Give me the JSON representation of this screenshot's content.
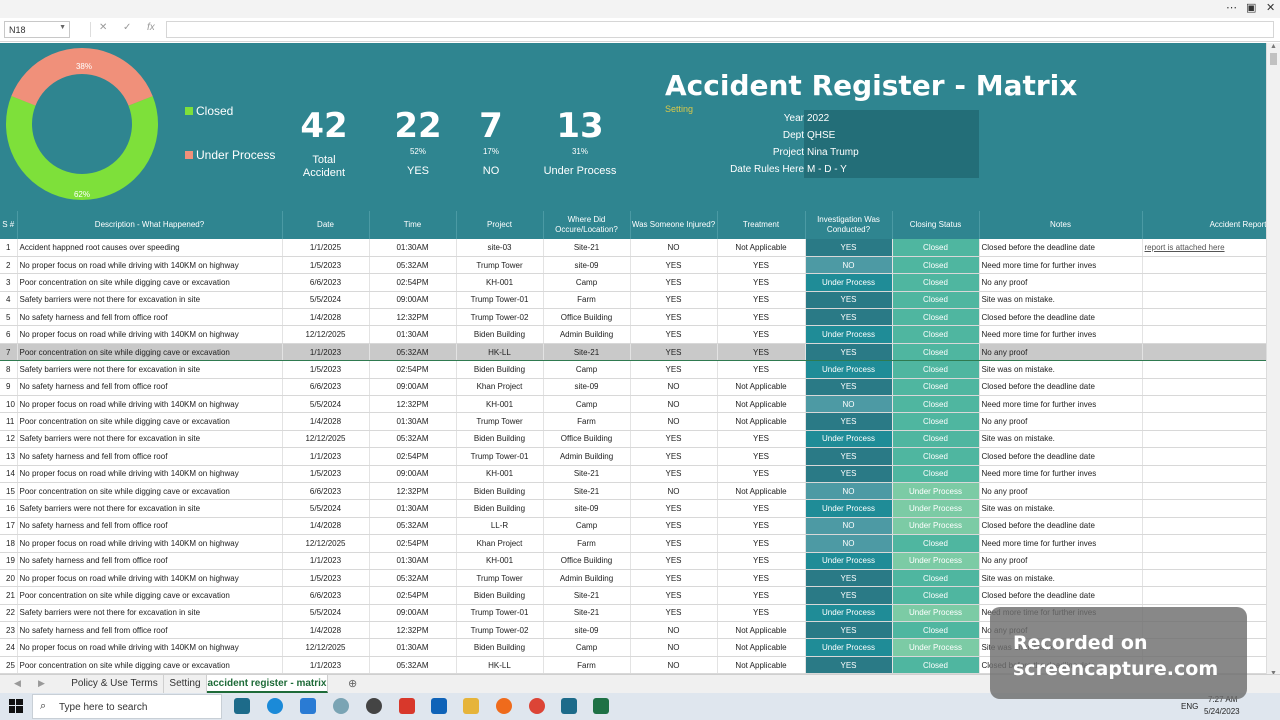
{
  "window": {
    "controls": [
      "⋯",
      "▣",
      "—",
      "☐",
      "✕"
    ]
  },
  "formula_bar": {
    "name_box": "N18",
    "cancel": "✕",
    "enter": "✓",
    "fx": "fx",
    "value": ""
  },
  "dashboard": {
    "title": "Accident Register - Matrix",
    "setting_link": "Setting",
    "donut": {
      "closed_pct_label": "62%",
      "under_process_pct_label": "38%",
      "closed_fraction": 0.62,
      "colors": {
        "closed": "#7ee03a",
        "under_process": "#f0907a"
      }
    },
    "legend": {
      "closed": "Closed",
      "under_process": "Under Process"
    },
    "kpis": [
      {
        "value": "42",
        "pct": "",
        "label": "Total Accident"
      },
      {
        "value": "22",
        "pct": "52%",
        "label": "YES"
      },
      {
        "value": "7",
        "pct": "17%",
        "label": "NO"
      },
      {
        "value": "13",
        "pct": "31%",
        "label": "Under Process"
      }
    ],
    "meta": [
      {
        "key": "Year",
        "value": "2022"
      },
      {
        "key": "Dept",
        "value": "QHSE"
      },
      {
        "key": "Project",
        "value": "Nina Trump"
      },
      {
        "key": "Date Rules Here",
        "value": "M - D - Y"
      }
    ]
  },
  "table": {
    "headers": [
      "S #",
      "Description - What Happened?",
      "Date",
      "Time",
      "Project",
      "Where Did Occure/Location?",
      "Was Someone Injured?",
      "Treatment",
      "Investigation Was Conducted?",
      "Closing Status",
      "Notes",
      "Accident Report"
    ],
    "rows": [
      [
        "1",
        "Accident happned root causes over speeding",
        "1/1/2025",
        "01:30AM",
        "site-03",
        "Site-21",
        "NO",
        "Not Applicable",
        "YES",
        "Closed",
        "Closed before the deadline date",
        "report is attached here"
      ],
      [
        "2",
        "No proper focus on road while driving with 140KM on highway",
        "1/5/2023",
        "05:32AM",
        "Trump Tower",
        "site-09",
        "YES",
        "YES",
        "NO",
        "Closed",
        "Need more time for further inves",
        ""
      ],
      [
        "3",
        "Poor concentration on site while digging cave or excavation",
        "6/6/2023",
        "02:54PM",
        "KH-001",
        "Camp",
        "YES",
        "YES",
        "Under Process",
        "Closed",
        "No any proof",
        ""
      ],
      [
        "4",
        "Safety barriers were not there for excavation in site",
        "5/5/2024",
        "09:00AM",
        "Trump Tower-01",
        "Farm",
        "YES",
        "YES",
        "YES",
        "Closed",
        "Site was on mistake.",
        ""
      ],
      [
        "5",
        "No safety harness and fell from office roof",
        "1/4/2028",
        "12:32PM",
        "Trump Tower-02",
        "Office Building",
        "YES",
        "YES",
        "YES",
        "Closed",
        "Closed before the deadline date",
        ""
      ],
      [
        "6",
        "No proper focus on road while driving with 140KM on highway",
        "12/12/2025",
        "01:30AM",
        "Biden Building",
        "Admin Building",
        "YES",
        "YES",
        "Under Process",
        "Closed",
        "Need more time for further inves",
        ""
      ],
      [
        "7",
        "Poor concentration on site while digging cave or excavation",
        "1/1/2023",
        "05:32AM",
        "HK-LL",
        "Site-21",
        "YES",
        "YES",
        "YES",
        "Closed",
        "No any proof",
        ""
      ],
      [
        "8",
        "Safety barriers were not there for excavation in site",
        "1/5/2023",
        "02:54PM",
        "Biden Building",
        "Camp",
        "YES",
        "YES",
        "Under Process",
        "Closed",
        "Site was on mistake.",
        ""
      ],
      [
        "9",
        "No safety harness and fell from office roof",
        "6/6/2023",
        "09:00AM",
        "Khan Project",
        "site-09",
        "NO",
        "Not Applicable",
        "YES",
        "Closed",
        "Closed before the deadline date",
        ""
      ],
      [
        "10",
        "No proper focus on road while driving with 140KM on highway",
        "5/5/2024",
        "12:32PM",
        "KH-001",
        "Camp",
        "NO",
        "Not Applicable",
        "NO",
        "Closed",
        "Need more time for further inves",
        ""
      ],
      [
        "11",
        "Poor concentration on site while digging cave or excavation",
        "1/4/2028",
        "01:30AM",
        "Trump Tower",
        "Farm",
        "NO",
        "Not Applicable",
        "YES",
        "Closed",
        "No any proof",
        ""
      ],
      [
        "12",
        "Safety barriers were not there for excavation in site",
        "12/12/2025",
        "05:32AM",
        "Biden Building",
        "Office Building",
        "YES",
        "YES",
        "Under Process",
        "Closed",
        "Site was on mistake.",
        ""
      ],
      [
        "13",
        "No safety harness and fell from office roof",
        "1/1/2023",
        "02:54PM",
        "Trump Tower-01",
        "Admin Building",
        "YES",
        "YES",
        "YES",
        "Closed",
        "Closed before the deadline date",
        ""
      ],
      [
        "14",
        "No proper focus on road while driving with 140KM on highway",
        "1/5/2023",
        "09:00AM",
        "KH-001",
        "Site-21",
        "YES",
        "YES",
        "YES",
        "Closed",
        "Need more time for further inves",
        ""
      ],
      [
        "15",
        "Poor concentration on site while digging cave or excavation",
        "6/6/2023",
        "12:32PM",
        "Biden Building",
        "Site-21",
        "NO",
        "Not Applicable",
        "NO",
        "Under Process",
        "No any proof",
        ""
      ],
      [
        "16",
        "Safety barriers were not there for excavation in site",
        "5/5/2024",
        "01:30AM",
        "Biden Building",
        "site-09",
        "YES",
        "YES",
        "Under Process",
        "Under Process",
        "Site was on mistake.",
        ""
      ],
      [
        "17",
        "No safety harness and fell from office roof",
        "1/4/2028",
        "05:32AM",
        "LL-R",
        "Camp",
        "YES",
        "YES",
        "NO",
        "Under Process",
        "Closed before the deadline date",
        ""
      ],
      [
        "18",
        "No proper focus on road while driving with 140KM on highway",
        "12/12/2025",
        "02:54PM",
        "Khan Project",
        "Farm",
        "YES",
        "YES",
        "NO",
        "Closed",
        "Need more time for further inves",
        ""
      ],
      [
        "19",
        "No safety harness and fell from office roof",
        "1/1/2023",
        "01:30AM",
        "KH-001",
        "Office Building",
        "YES",
        "YES",
        "Under Process",
        "Under Process",
        "No any proof",
        ""
      ],
      [
        "20",
        "No proper focus on road while driving with 140KM on highway",
        "1/5/2023",
        "05:32AM",
        "Trump Tower",
        "Admin Building",
        "YES",
        "YES",
        "YES",
        "Closed",
        "Site was on mistake.",
        ""
      ],
      [
        "21",
        "Poor concentration on site while digging cave or excavation",
        "6/6/2023",
        "02:54PM",
        "Biden Building",
        "Site-21",
        "YES",
        "YES",
        "YES",
        "Closed",
        "Closed before the deadline date",
        ""
      ],
      [
        "22",
        "Safety barriers were not there for excavation in site",
        "5/5/2024",
        "09:00AM",
        "Trump Tower-01",
        "Site-21",
        "YES",
        "YES",
        "Under Process",
        "Under Process",
        "Need more time for further inves",
        ""
      ],
      [
        "23",
        "No safety harness and fell from office roof",
        "1/4/2028",
        "12:32PM",
        "Trump Tower-02",
        "site-09",
        "NO",
        "Not Applicable",
        "YES",
        "Closed",
        "No any proof",
        ""
      ],
      [
        "24",
        "No proper focus on road while driving with 140KM on highway",
        "12/12/2025",
        "01:30AM",
        "Biden Building",
        "Camp",
        "NO",
        "Not Applicable",
        "Under Process",
        "Under Process",
        "Site was on mistake.",
        ""
      ],
      [
        "25",
        "Poor concentration on site while digging cave or excavation",
        "1/1/2023",
        "05:32AM",
        "HK-LL",
        "Farm",
        "NO",
        "Not Applicable",
        "YES",
        "Closed",
        "Closed before the deadline date",
        ""
      ]
    ],
    "selected_row": 7,
    "colors": {
      "inv_yes": "#2a7a86",
      "inv_no": "#4d9aa4",
      "inv_process": "#1f8c97",
      "closed": "#4fb6a0",
      "under_process": "#7ccba5"
    }
  },
  "sheet_tabs": [
    "Policy & Use Terms",
    "Setting",
    "accident register - matrix"
  ],
  "active_tab": "accident register - matrix",
  "taskbar": {
    "search_placeholder": "Type here to search",
    "tray_lang": "ENG",
    "time": "7:27 AM",
    "date": "5/24/2023"
  },
  "watermark": {
    "line1": "Recorded on",
    "line2": "screencapture.com"
  }
}
